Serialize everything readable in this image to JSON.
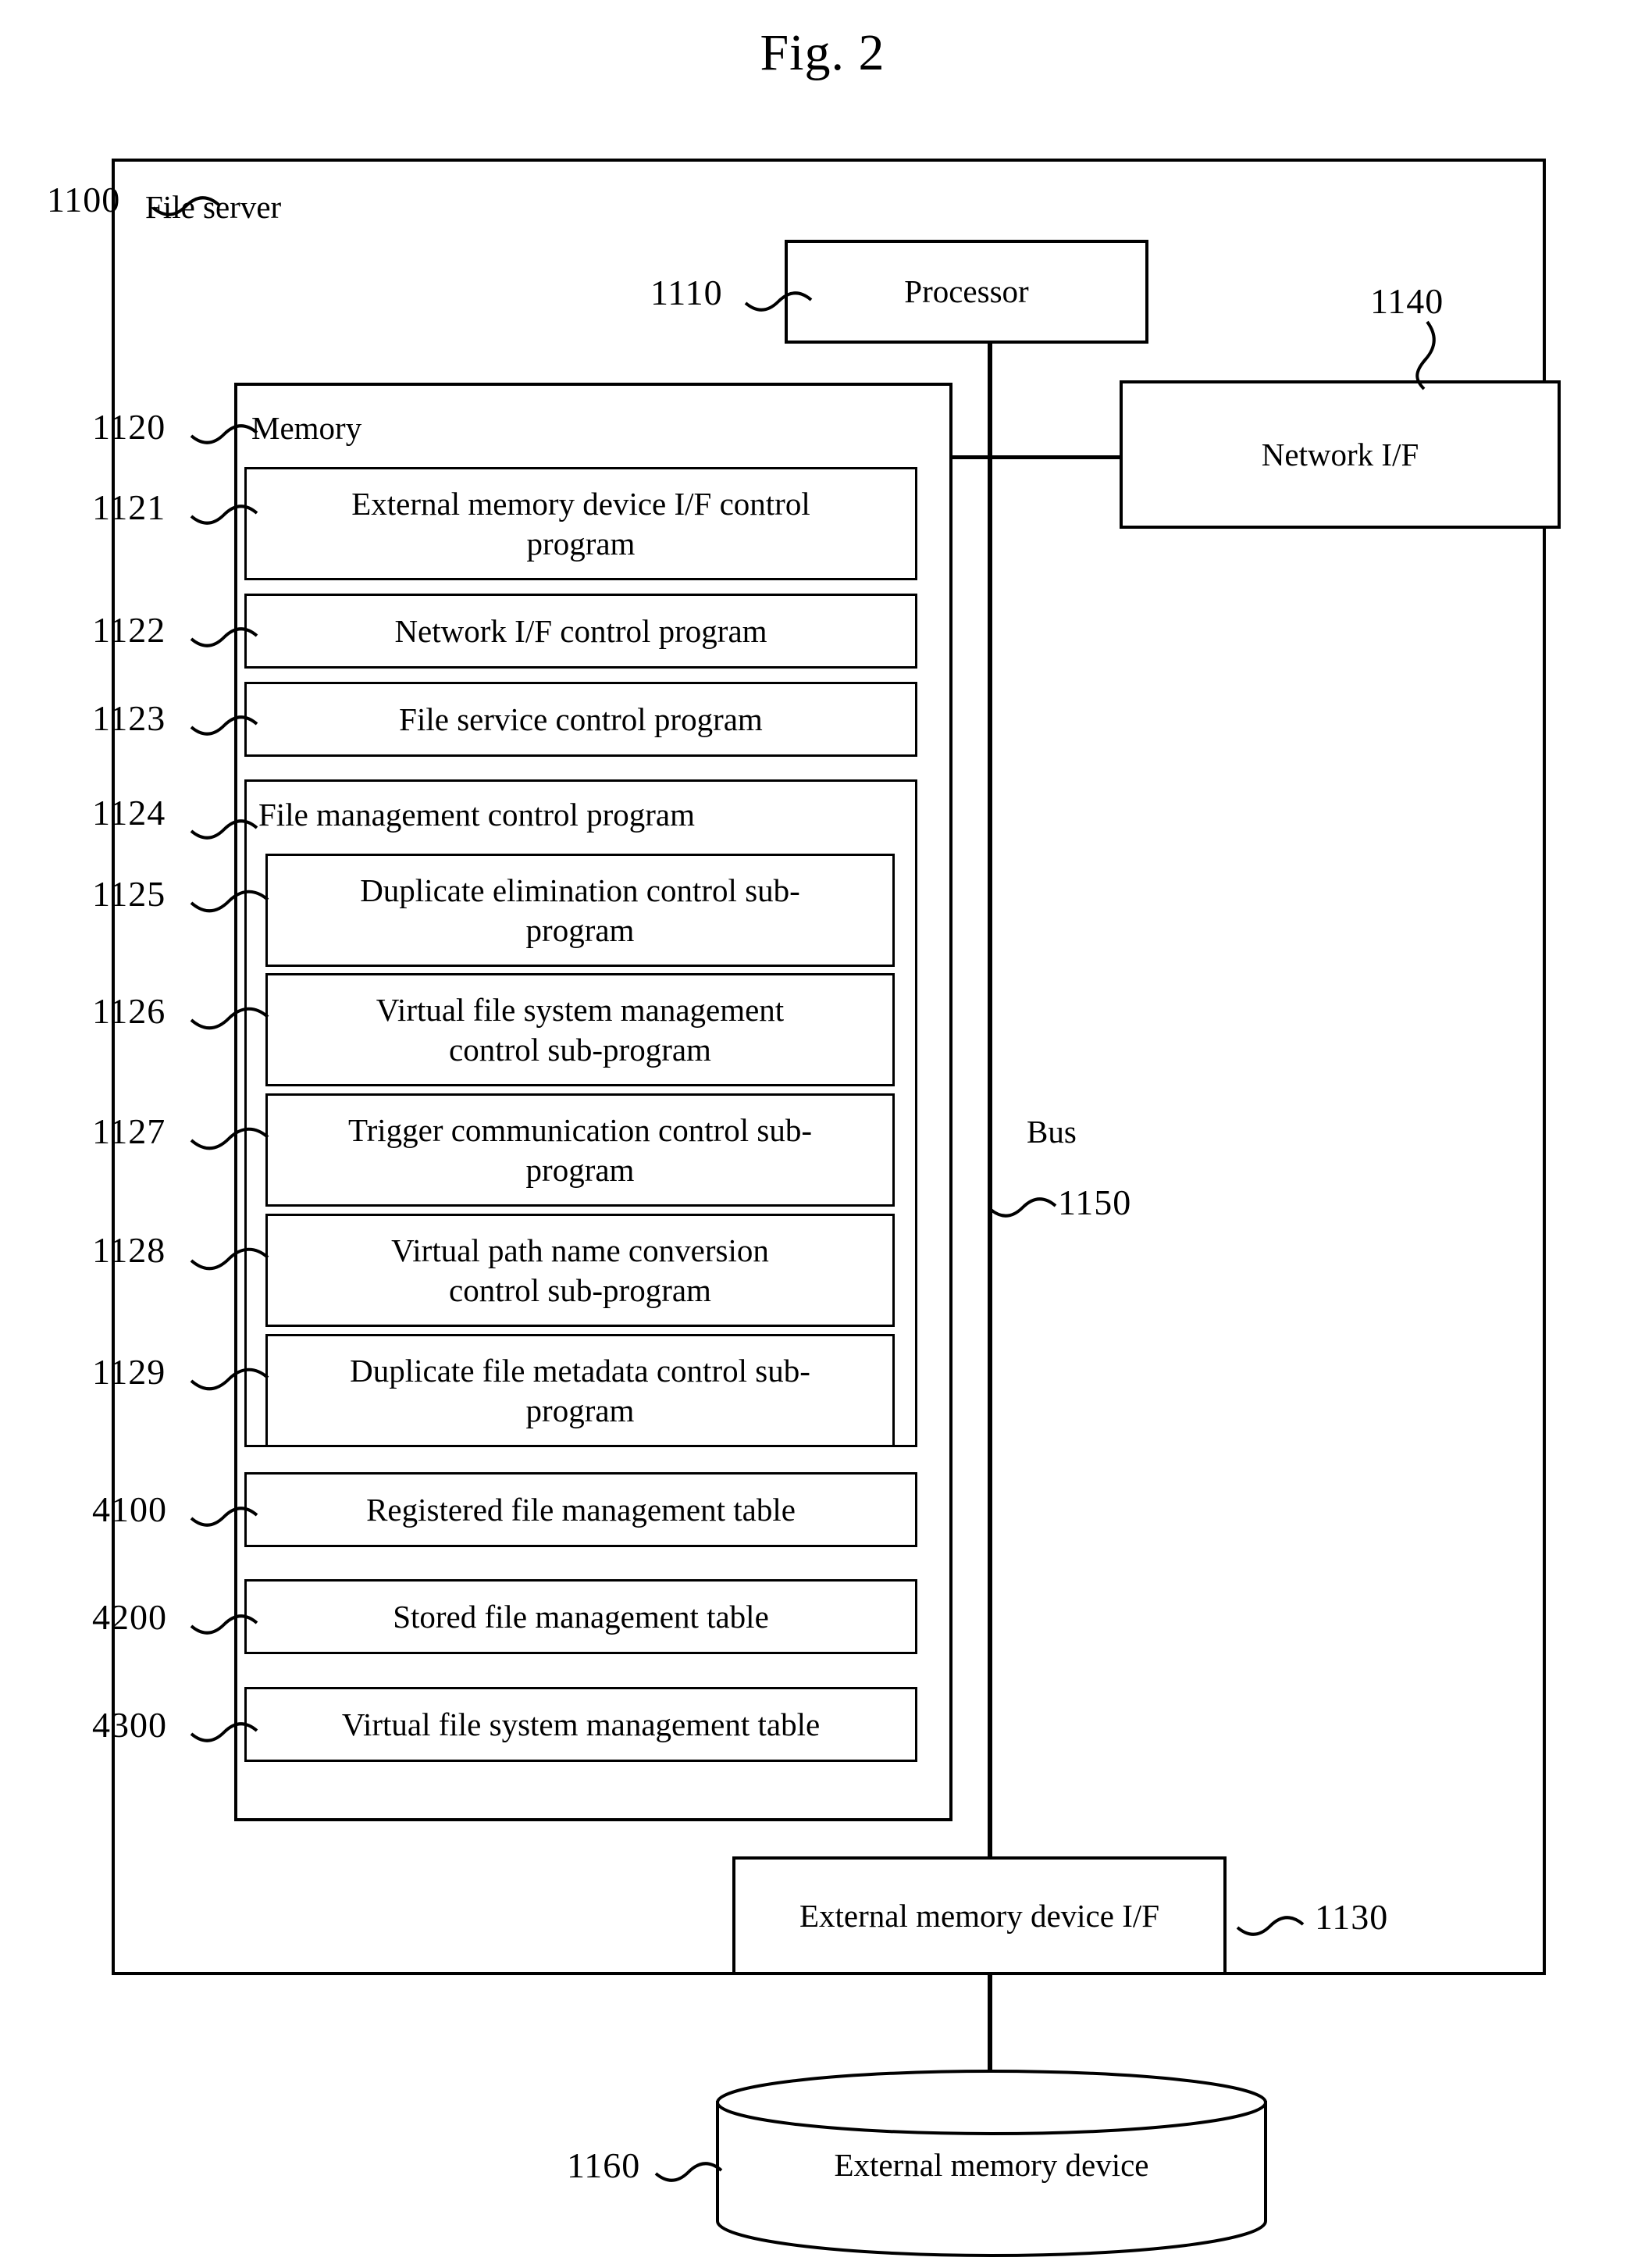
{
  "figure": {
    "title": "Fig. 2"
  },
  "file_server": {
    "ref": "1100",
    "label": "File server"
  },
  "processor": {
    "ref": "1110",
    "label": "Processor"
  },
  "network_if": {
    "ref": "1140",
    "label": "Network I/F"
  },
  "bus": {
    "label": "Bus",
    "ref": "1150"
  },
  "memory": {
    "ref": "1120",
    "label": "Memory",
    "programs": [
      {
        "ref": "1121",
        "label": "External memory device I/F control program"
      },
      {
        "ref": "1122",
        "label": "Network I/F control program"
      },
      {
        "ref": "1123",
        "label": "File service control program"
      }
    ],
    "file_management": {
      "ref": "1124",
      "label": "File management control program",
      "sub_programs": [
        {
          "ref": "1125",
          "label": "Duplicate elimination control sub-program"
        },
        {
          "ref": "1126",
          "label": "Virtual file system management control sub-program"
        },
        {
          "ref": "1127",
          "label": "Trigger communication control sub-program"
        },
        {
          "ref": "1128",
          "label": "Virtual path name conversion control sub-program"
        },
        {
          "ref": "1129",
          "label": "Duplicate file metadata control sub-program"
        }
      ]
    },
    "tables": [
      {
        "ref": "4100",
        "label": "Registered file management table"
      },
      {
        "ref": "4200",
        "label": "Stored file management table"
      },
      {
        "ref": "4300",
        "label": "Virtual file system management table"
      }
    ]
  },
  "external_memory_if": {
    "ref": "1130",
    "label": "External memory device I/F"
  },
  "external_memory_device": {
    "ref": "1160",
    "label": "External memory device"
  },
  "colors": {
    "line": "#000000",
    "background": "#ffffff"
  }
}
